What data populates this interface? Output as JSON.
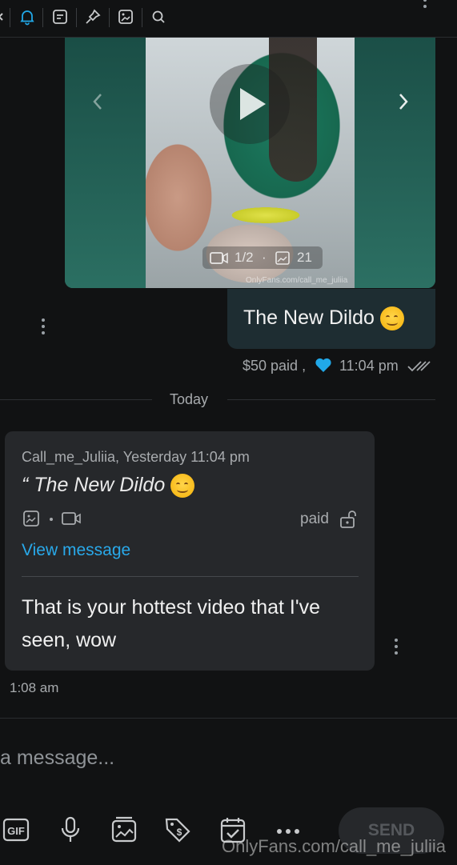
{
  "colors": {
    "accent": "#21a8e8",
    "background": "#111213",
    "bubble_sent": "#1e2d32",
    "card_bg": "#26282b",
    "link": "#29a9ea"
  },
  "toolbar": {
    "icons": [
      "chevron-left-icon",
      "bell-icon",
      "note-icon",
      "pin-icon",
      "image-icon",
      "search-icon",
      "more-vertical-icon"
    ],
    "active_icon": "bell-icon"
  },
  "media": {
    "video_count": "1/2",
    "image_count": "21",
    "watermark": "OnlyFans.com/call_me_juliia"
  },
  "sent_message": {
    "text": "The New Dildo",
    "price": "$50 paid ,",
    "time": "11:04 pm",
    "status": "read"
  },
  "divider": {
    "label": "Today"
  },
  "received_message": {
    "reply_author": "Call_me_Juliia, Yesterday 11:04 pm",
    "reply_quote": "“ The New Dildo",
    "reply_paid_label": "paid",
    "view_link": "View message",
    "body": "That is your hottest video that I've seen, wow",
    "time": "1:08 am"
  },
  "composer": {
    "placeholder": "a message...",
    "tools": [
      "gif-icon",
      "microphone-icon",
      "media-icon",
      "price-tag-icon",
      "schedule-icon",
      "more-horizontal-icon"
    ],
    "send_label": "SEND"
  },
  "watermark": "OnlyFans.com/call_me_juliia"
}
